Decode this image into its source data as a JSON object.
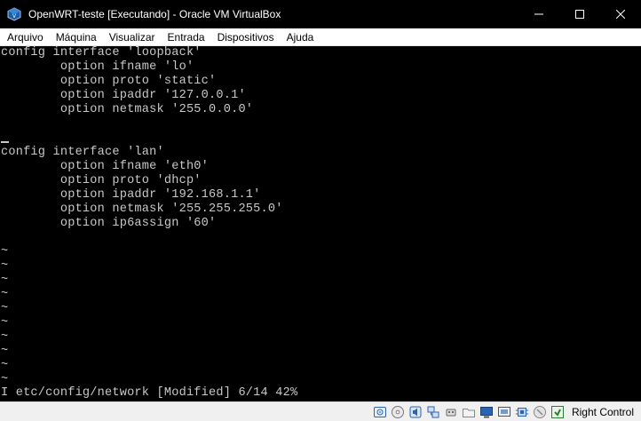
{
  "window": {
    "title": "OpenWRT-teste [Executando] - Oracle VM VirtualBox"
  },
  "menu": {
    "items": [
      "Arquivo",
      "Máquina",
      "Visualizar",
      "Entrada",
      "Dispositivos",
      "Ajuda"
    ]
  },
  "terminal": {
    "lines": [
      "config interface 'loopback'",
      "        option ifname 'lo'",
      "        option proto 'static'",
      "        option ipaddr '127.0.0.1'",
      "        option netmask '255.0.0.0'",
      "",
      "",
      "config interface 'lan'",
      "        option ifname 'eth0'",
      "        option proto 'dhcp'",
      "        option ipaddr '192.168.1.1'",
      "        option netmask '255.255.255.0'",
      "        option ip6assign '60'",
      "",
      "~",
      "~",
      "~",
      "~",
      "~",
      "~",
      "~",
      "~",
      "~",
      "~",
      "",
      "I etc/config/network [Modified] 6/14 42%"
    ]
  },
  "statusbar": {
    "host_key": "Right Control",
    "icons": [
      "hard-disk-icon",
      "optical-drive-icon",
      "audio-icon",
      "network-icon",
      "usb-icon",
      "shared-folders-icon",
      "display-icon",
      "video-capture-icon",
      "cpu-icon",
      "mouse-integration-icon",
      "keyboard-capture-icon"
    ]
  },
  "colors": {
    "terminal_bg": "#000000",
    "terminal_fg": "#c8c8c8",
    "titlebar_bg": "#000000",
    "menubar_bg": "#ffffff",
    "statusbar_bg": "#f0f0f0"
  }
}
